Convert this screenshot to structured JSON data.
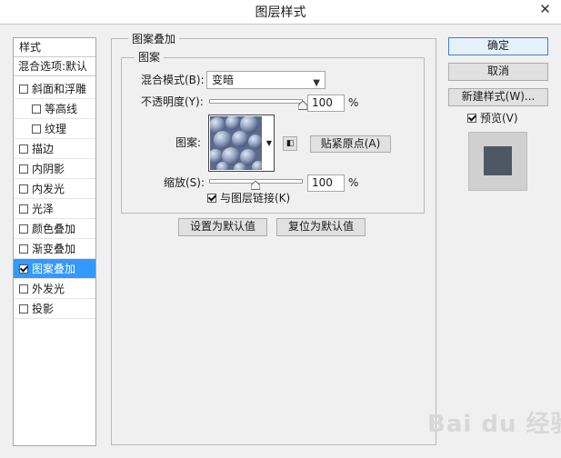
{
  "window": {
    "title": "图层样式",
    "close_glyph": "✕"
  },
  "sidebar": {
    "style_header": "样式",
    "blend_header": "混合选项:默认",
    "items": [
      {
        "label": "斜面和浮雕",
        "checked": false
      },
      {
        "label": "等高线",
        "checked": false
      },
      {
        "label": "纹理",
        "checked": false
      },
      {
        "label": "描边",
        "checked": false
      },
      {
        "label": "内阴影",
        "checked": false
      },
      {
        "label": "内发光",
        "checked": false
      },
      {
        "label": "光泽",
        "checked": false
      },
      {
        "label": "颜色叠加",
        "checked": false
      },
      {
        "label": "渐变叠加",
        "checked": false
      },
      {
        "label": "图案叠加",
        "checked": true,
        "selected": true
      },
      {
        "label": "外发光",
        "checked": false
      },
      {
        "label": "投影",
        "checked": false
      }
    ]
  },
  "main": {
    "group_title": "图案叠加",
    "pattern_group_title": "图案",
    "blend_mode_label": "混合模式(B):",
    "blend_mode_value": "变暗",
    "opacity_label": "不透明度(Y):",
    "opacity_value": "100",
    "opacity_unit": "%",
    "opacity_level": 1.0,
    "pattern_label": "图案:",
    "snap_origin_label": "贴紧原点(A)",
    "scale_label": "缩放(S):",
    "scale_value": "100",
    "scale_unit": "%",
    "link_label": "与图层链接(K)",
    "link_checked": true,
    "set_default_label": "设置为默认值",
    "reset_default_label": "复位为默认值"
  },
  "right": {
    "ok_label": "确定",
    "cancel_label": "取消",
    "new_style_label": "新建样式(W)...",
    "preview_label": "预览(V)",
    "preview_checked": true
  },
  "watermark": "Bai du 经验"
}
